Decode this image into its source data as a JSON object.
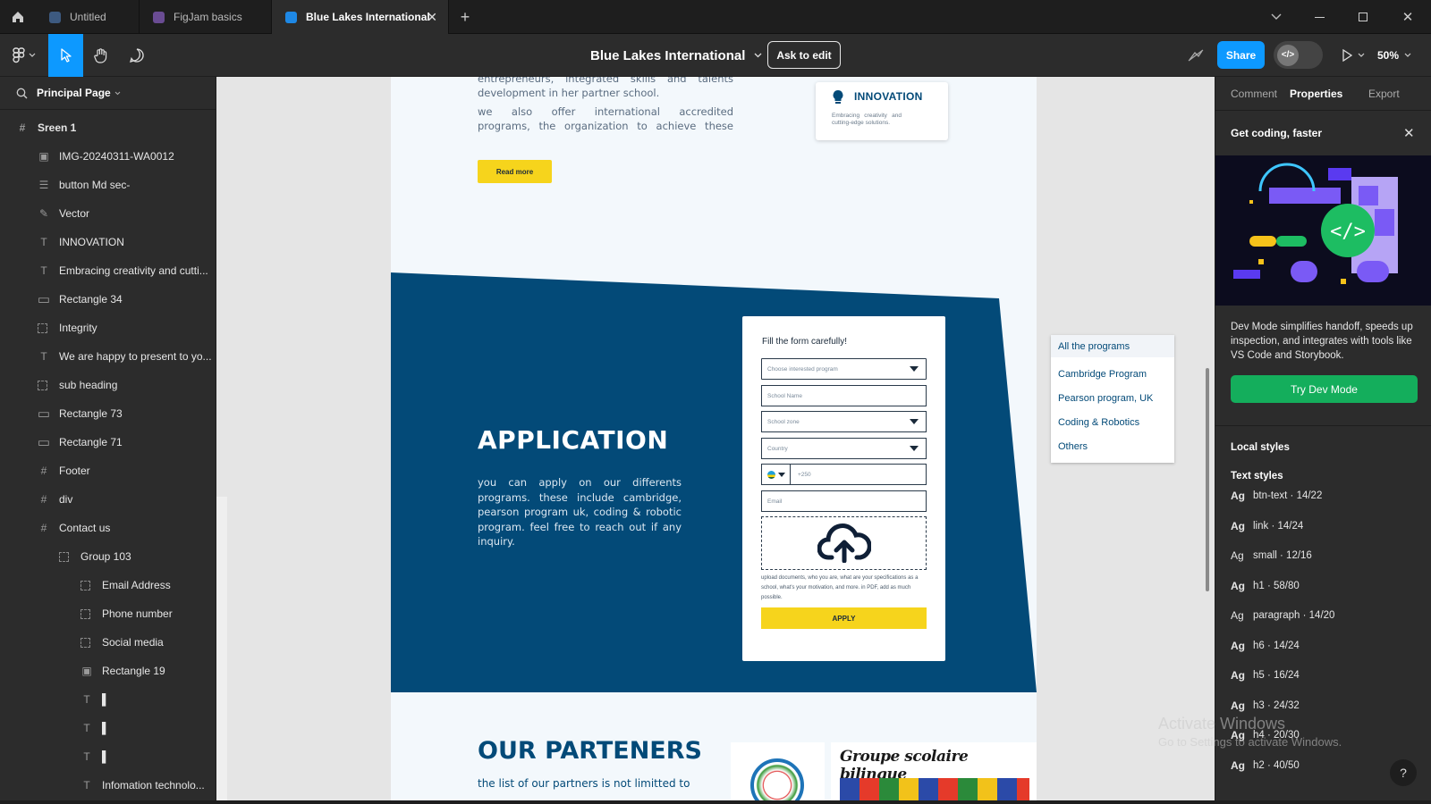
{
  "tabs": [
    {
      "label": "Untitled",
      "color": "#3d5a80"
    },
    {
      "label": "FigJam basics",
      "color": "#6a4c93"
    },
    {
      "label": "Blue Lakes International",
      "color": "#1e88e5"
    }
  ],
  "toolbar": {
    "file_title": "Blue Lakes International",
    "ask_to_edit": "Ask to edit",
    "share": "Share",
    "zoom": "50%"
  },
  "layers_panel": {
    "page_name": "Principal Page",
    "items": [
      {
        "label": "Sreen 1",
        "icon": "frame-icon"
      },
      {
        "label": "IMG-20240311-WA0012",
        "icon": "image-icon"
      },
      {
        "label": "button Md sec-",
        "icon": "auto-layout-icon"
      },
      {
        "label": "Vector",
        "icon": "vector-icon"
      },
      {
        "label": "INNOVATION",
        "icon": "text-icon"
      },
      {
        "label": "Embracing creativity and cutti...",
        "icon": "text-icon"
      },
      {
        "label": "Rectangle 34",
        "icon": "rectangle-icon"
      },
      {
        "label": "Integrity",
        "icon": "group-icon"
      },
      {
        "label": "We are happy to present to yo...",
        "icon": "text-icon"
      },
      {
        "label": "sub heading",
        "icon": "group-icon"
      },
      {
        "label": "Rectangle 73",
        "icon": "rectangle-icon"
      },
      {
        "label": "Rectangle 71",
        "icon": "rectangle-icon"
      },
      {
        "label": "Footer",
        "icon": "frame-icon"
      },
      {
        "label": "div",
        "icon": "frame-icon"
      },
      {
        "label": "Contact us",
        "icon": "frame-icon"
      },
      {
        "label": "Group 103",
        "icon": "group-icon"
      },
      {
        "label": "Email Address",
        "icon": "group-icon"
      },
      {
        "label": "Phone number",
        "icon": "group-icon"
      },
      {
        "label": "Social media",
        "icon": "group-icon"
      },
      {
        "label": "Rectangle 19",
        "icon": "image-icon"
      },
      {
        "label": "▌",
        "icon": "text-icon"
      },
      {
        "label": "▌",
        "icon": "text-icon"
      },
      {
        "label": "▌",
        "icon": "text-icon"
      },
      {
        "label": "Infomation technolo...",
        "icon": "text-icon"
      }
    ]
  },
  "design": {
    "intro_line1": "entrepreneurs, integrated skills and talents",
    "intro_line2": "development in her partner school.",
    "intro_line3": "we also offer international accredited",
    "intro_line4": "programs, the organization to achieve these",
    "read_more": "Read more",
    "innovation_title": "INNOVATION",
    "innovation_text": "Embracing creativity and cutting-edge solutions.",
    "application_title": "APPLICATION",
    "application_text": "you can apply on our differents programs. these include cambridge, pearson program uk, coding & robotic program. feel free to reach out if any inquiry.",
    "form": {
      "heading": "Fill the form carefully!",
      "program_placeholder": "Choose interested program",
      "school_name": "School Name",
      "school_zone": "School zone",
      "country": "Country",
      "phone_prefix": "+250",
      "email": "Email",
      "upload_note": "upload documents, who you are, what are your specifications as a school, what's your motivation, and more. in PDF, add as much possible.",
      "apply": "APPLY"
    },
    "dropdown": [
      "All the programs",
      "Cambridge Program",
      "Pearson program, UK",
      "Coding & Robotics",
      "Others"
    ],
    "partners_title": "OUR PARTENERS",
    "partners_text": "the list of our partners is not limitted to",
    "partner_banner": "Groupe scolaire bilingue",
    "colors": {
      "navy": "#034a78",
      "yellow": "#f6d41c",
      "pale": "#f3f8fc"
    }
  },
  "right_panel": {
    "tabs": [
      "Comment",
      "Properties",
      "Export"
    ],
    "promo_title": "Get coding, faster",
    "promo_text": "Dev Mode simplifies handoff, speeds up inspection, and integrates with tools like VS Code and Storybook.",
    "promo_button": "Try Dev Mode",
    "local_styles": "Local styles",
    "text_styles": "Text styles",
    "styles": [
      {
        "ag": "Ag",
        "label": "btn-text · 14/22"
      },
      {
        "ag": "Ag",
        "label": "link · 14/24"
      },
      {
        "ag": "Ag",
        "label": "small · 12/16"
      },
      {
        "ag": "Ag",
        "label": "h1 · 58/80"
      },
      {
        "ag": "Ag",
        "label": "paragraph · 14/20"
      },
      {
        "ag": "Ag",
        "label": "h6 · 14/24"
      },
      {
        "ag": "Ag",
        "label": "h5 · 16/24"
      },
      {
        "ag": "Ag",
        "label": "h3 · 24/32"
      },
      {
        "ag": "Ag",
        "label": "h4 · 20/30"
      },
      {
        "ag": "Ag",
        "label": "h2 · 40/50"
      }
    ]
  },
  "watermark": {
    "line1": "Activate Windows",
    "line2": "Go to Settings to activate Windows."
  },
  "help": "?"
}
